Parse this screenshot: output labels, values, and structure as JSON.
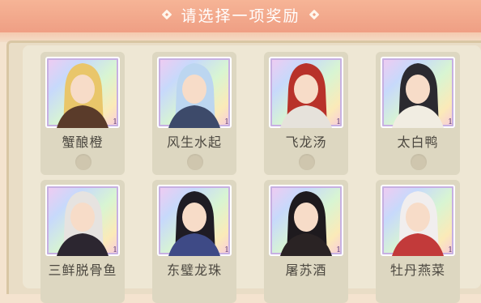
{
  "header": {
    "title": "请选择一项奖励",
    "left_icon": "sparkle-icon",
    "right_icon": "sparkle-icon"
  },
  "rewards": [
    {
      "name": "蟹酿橙",
      "count": "1",
      "selected": false,
      "hair": "#e9c66a",
      "robe": "#5a3b2a"
    },
    {
      "name": "风生水起",
      "count": "1",
      "selected": false,
      "hair": "#bcd6f0",
      "robe": "#3d4a6a"
    },
    {
      "name": "飞龙汤",
      "count": "1",
      "selected": false,
      "hair": "#b8322a",
      "robe": "#e6e2db"
    },
    {
      "name": "太白鸭",
      "count": "1",
      "selected": false,
      "hair": "#2b2a30",
      "robe": "#f1ede2"
    },
    {
      "name": "三鲜脱骨鱼",
      "count": "1",
      "selected": false,
      "hair": "#e6e3e0",
      "robe": "#2c2630"
    },
    {
      "name": "东璧龙珠",
      "count": "1",
      "selected": false,
      "hair": "#1f1c24",
      "robe": "#3e4a86"
    },
    {
      "name": "屠苏酒",
      "count": "1",
      "selected": false,
      "hair": "#1e1a1e",
      "robe": "#2a2324"
    },
    {
      "name": "牡丹燕菜",
      "count": "1",
      "selected": false,
      "hair": "#f1eeee",
      "robe": "#c23a3a"
    }
  ]
}
